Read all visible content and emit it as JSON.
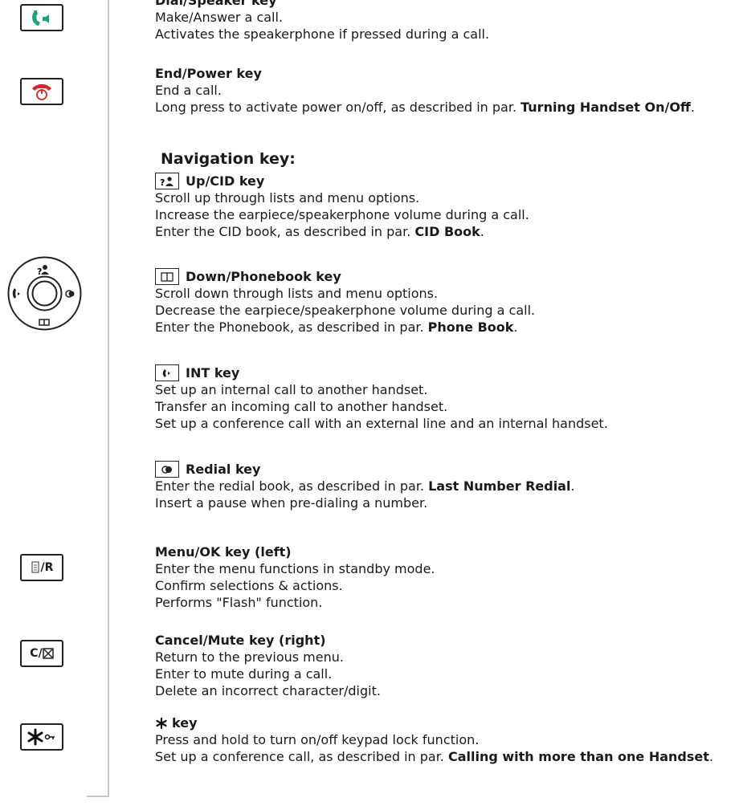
{
  "sections": {
    "dial": {
      "title": "Dial/Speaker key",
      "lines": [
        "Make/Answer a call.",
        "Activates the speakerphone if pressed during a call."
      ]
    },
    "end": {
      "title": "End/Power key",
      "line1": "End a call.",
      "line2_pre": "Long press to activate power on/off, as described in par.",
      "line2_bold": "Turning Handset On/Off",
      "line2_post": "."
    },
    "nav_heading": "Navigation key:",
    "up": {
      "title": "Up/CID key",
      "line1": "Scroll up through lists and menu options.",
      "line2": "Increase the earpiece/speakerphone volume during a call.",
      "line3_pre": "Enter the CID book, as described in par.",
      "line3_bold": "CID Book",
      "line3_post": "."
    },
    "down": {
      "title": "Down/Phonebook key",
      "line1": "Scroll down through lists and menu options.",
      "line2": "Decrease the earpiece/speakerphone volume during a call.",
      "line3_pre": "Enter the Phonebook, as described in par.",
      "line3_bold": "Phone Book",
      "line3_post": "."
    },
    "int": {
      "title": "INT key",
      "line1": "Set up an internal call to another handset.",
      "line2": "Transfer an incoming call to another handset.",
      "line3": "Set up a conference call with an external line and an internal handset."
    },
    "redial": {
      "title": "Redial key",
      "line1_pre": "Enter the redial book, as described in par.",
      "line1_bold": "Last Number Redial",
      "line1_post": ".",
      "line2": "Insert a pause when pre-dialing a number."
    },
    "menu": {
      "title": "Menu/OK key (left)",
      "line1": "Enter the menu functions in standby mode.",
      "line2": "Confirm selections & actions.",
      "line3": "Performs \"Flash\" function."
    },
    "cancel": {
      "title": "Cancel/Mute key (right)",
      "line1": "Return to the previous menu.",
      "line2": "Enter to mute during a call.",
      "line3": "Delete an incorrect character/digit."
    },
    "star": {
      "title": "key",
      "line1": "Press and hold to turn on/off keypad lock function.",
      "line2_pre": "Set up a conference call, as described in par.",
      "line2_bold": "Calling with more than one Handset",
      "line2_post": "."
    }
  },
  "keys": {
    "menu_r": "R",
    "cancel_c": "C/"
  },
  "colors": {
    "dial_green": "#1aa37a",
    "end_red": "#e0202a",
    "rule": "#c8c8c8"
  }
}
